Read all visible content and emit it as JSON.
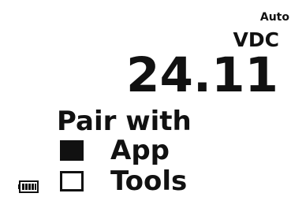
{
  "display": {
    "range_mode": "Auto",
    "unit": "VDC",
    "reading": "24.11"
  },
  "pairing": {
    "title": "Pair with",
    "options": [
      {
        "label": "App",
        "selected": true
      },
      {
        "label": "Tools",
        "selected": false
      }
    ]
  },
  "status": {
    "battery_icon": "battery-full-icon",
    "battery_level": 1.0
  },
  "colors": {
    "foreground": "#111111",
    "background": "#ffffff"
  }
}
